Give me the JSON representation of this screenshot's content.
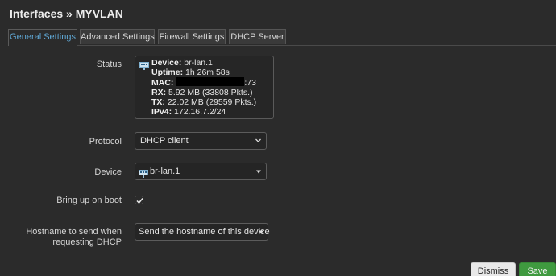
{
  "header": {
    "title": "Interfaces » MYVLAN"
  },
  "tabs": [
    {
      "label": "General Settings",
      "active": true
    },
    {
      "label": "Advanced Settings",
      "active": false
    },
    {
      "label": "Firewall Settings",
      "active": false
    },
    {
      "label": "DHCP Server",
      "active": false
    }
  ],
  "status": {
    "label": "Status",
    "device_key": "Device:",
    "device_value": "br-lan.1",
    "uptime_key": "Uptime:",
    "uptime_value": "1h 26m 58s",
    "mac_key": "MAC:",
    "mac_suffix": ":73",
    "rx_key": "RX:",
    "rx_value": "5.92 MB (33808 Pkts.)",
    "tx_key": "TX:",
    "tx_value": "22.02 MB (29559 Pkts.)",
    "ipv4_key": "IPv4:",
    "ipv4_value": "172.16.7.2/24"
  },
  "protocol": {
    "label": "Protocol",
    "value": "DHCP client"
  },
  "device": {
    "label": "Device",
    "value": "br-lan.1"
  },
  "boot": {
    "label": "Bring up on boot",
    "checked": true
  },
  "hostname": {
    "label_line1": "Hostname to send when",
    "label_line2": "requesting DHCP",
    "value": "Send the hostname of this device"
  },
  "buttons": {
    "dismiss": "Dismiss",
    "save": "Save"
  },
  "colors": {
    "accent_tab": "#5fa7d4",
    "save_green": "#3f9a3f"
  },
  "icons": [
    "network-device-icon",
    "chevron-down-icon",
    "caret-down-icon",
    "checkmark-icon"
  ]
}
